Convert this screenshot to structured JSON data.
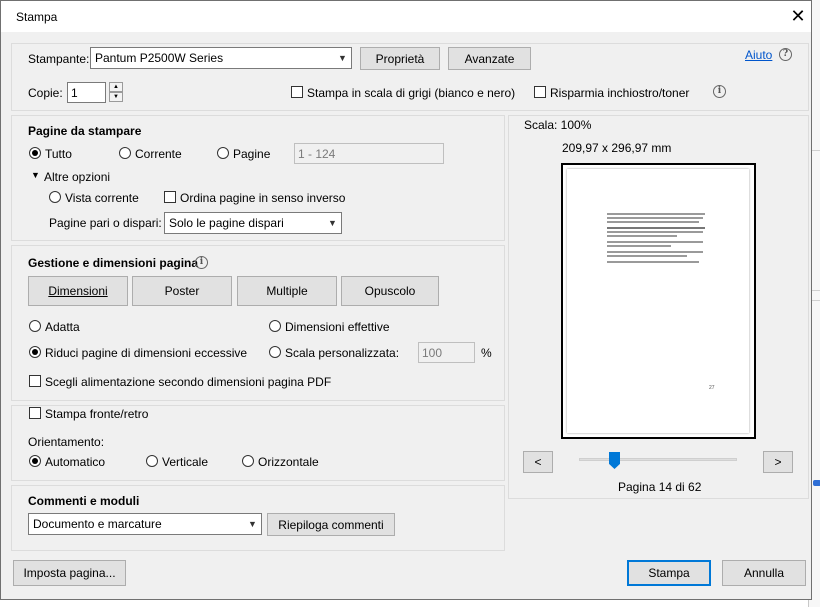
{
  "window": {
    "title": "Stampa",
    "close_glyph": "✕"
  },
  "printer": {
    "label": "Stampante:",
    "selected": "Pantum P2500W Series",
    "properties_button": "Proprietà",
    "advanced_button": "Avanzate",
    "help_link": "Aiuto",
    "copies_label": "Copie:",
    "copies_value": "1",
    "grayscale_label": "Stampa in scala di grigi (bianco e nero)",
    "grayscale_checked": false,
    "save_ink_label": "Risparmia inchiostro/toner",
    "save_ink_checked": false
  },
  "pages": {
    "title": "Pagine da stampare",
    "all_label": "Tutto",
    "current_label": "Corrente",
    "pages_label": "Pagine",
    "pages_placeholder": "1 - 124",
    "selected": "Tutto",
    "more_options_label": "Altre opzioni",
    "current_view_label": "Vista corrente",
    "reverse_label": "Ordina pagine in senso inverso",
    "odd_even_label": "Pagine pari o dispari:",
    "odd_even_value": "Solo le pagine dispari"
  },
  "sizing": {
    "title": "Gestione e dimensioni pagina",
    "tabs": [
      "Dimensioni",
      "Poster",
      "Multiple",
      "Opuscolo"
    ],
    "fit_label": "Adatta",
    "actual_size_label": "Dimensioni effettive",
    "shrink_label": "Riduci pagine di dimensioni eccessive",
    "custom_scale_label": "Scala personalizzata:",
    "custom_scale_value": "100",
    "percent": "%",
    "selected": "Riduci pagine di dimensioni eccessive",
    "paper_source_label": "Scegli alimentazione secondo dimensioni pagina PDF"
  },
  "duplex": {
    "label": "Stampa fronte/retro",
    "orientation_label": "Orientamento:",
    "auto_label": "Automatico",
    "portrait_label": "Verticale",
    "landscape_label": "Orizzontale",
    "selected": "Automatico"
  },
  "comments": {
    "title": "Commenti e moduli",
    "value": "Documento e marcature",
    "summarize_button": "Riepiloga commenti"
  },
  "preview": {
    "scale": "Scala: 100%",
    "dimensions": "209,97 x 296,97 mm",
    "page_number_on_sheet": "27",
    "prev_glyph": "<",
    "next_glyph": ">",
    "page_indicator": "Pagina 14 di 62",
    "slider_position": 0.22
  },
  "footer": {
    "page_setup_button": "Imposta pagina...",
    "print_button": "Stampa",
    "cancel_button": "Annulla"
  },
  "icons": {
    "help": "help-icon",
    "info": "info-icon",
    "dropdown": "chevron-down-icon"
  },
  "colors": {
    "accent": "#0078d7",
    "link": "#0055cc",
    "dialog_bg": "#f0f0f0"
  }
}
